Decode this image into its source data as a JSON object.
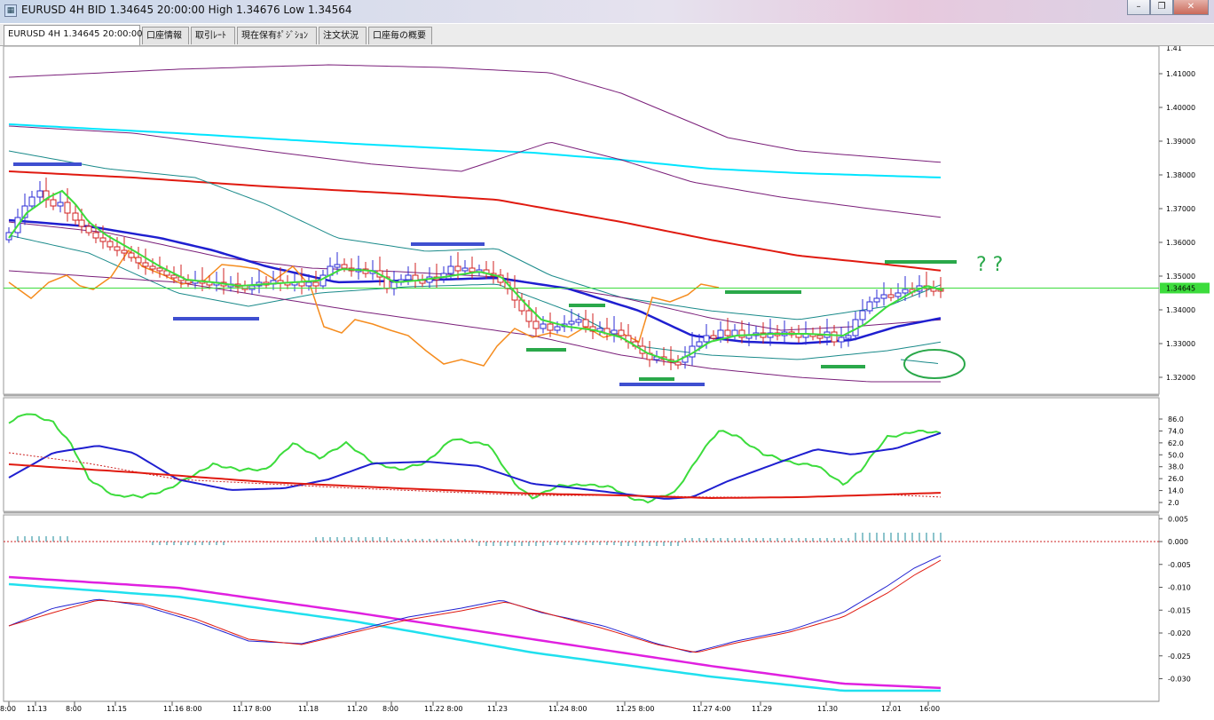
{
  "window": {
    "title": "EURUSD 4H BID 1.34645 20:00:00 High 1.34676 Low 1.34564",
    "icon": "chart-app-icon",
    "controls": [
      "minimize-icon",
      "restore-icon",
      "close-icon"
    ]
  },
  "tabs": [
    {
      "label": "EURUSD 4H 1.34645 20:00:00",
      "active": true
    },
    {
      "label": "口座情報"
    },
    {
      "label": "取引ﾚｰﾄ"
    },
    {
      "label": "現在保有ﾎﾟｼﾞｼｮﾝ"
    },
    {
      "label": "注文状況"
    },
    {
      "label": "口座毎の概要"
    }
  ],
  "chart_data": [
    {
      "type": "candlestick",
      "symbol": "EURUSD",
      "timeframe": "4H",
      "current_price": "1.34645",
      "ylim": [
        1.316,
        1.416
      ],
      "y_ticks": [
        "1.41000",
        "1.40000",
        "1.39000",
        "1.38000",
        "1.37000",
        "1.36000",
        "1.35000",
        "1.34000",
        "1.33000",
        "1.32000"
      ],
      "top_partial_tick": "1.4",
      "x_ticks": [
        "8:00",
        "11.13",
        "8:00",
        "11.15",
        "11.16 8:00",
        "11.17 8:00",
        "11.18",
        "11.20",
        "8:00",
        "11.22 8:00",
        "11.23",
        "11.24 8:00",
        "11.25 8:00",
        "11.27 4:00",
        "11.29",
        "11.30",
        "12.01",
        "16:00"
      ],
      "annotation": "? ?",
      "colors": {
        "up_candle": "#2b2bd6",
        "down_candle": "#d02020",
        "ma_fast": "#3cdc3c",
        "ma_mid": "#1f1fd0",
        "ma_slow": "#e01a10",
        "ma_long": "#00e5ff",
        "band_outer": "#7a1f7a",
        "band_inner": "#1a8a8a",
        "bar_line": "#f58c1e",
        "price_line": "#3cdc3c",
        "marks_blue": "#3f4fd0",
        "marks_green": "#2aa84a"
      }
    },
    {
      "type": "line",
      "name": "stochastic",
      "ylim": [
        0,
        100
      ],
      "y_ticks": [
        "86.0",
        "74.0",
        "62.0",
        "50.0",
        "38.0",
        "26.0",
        "14.0",
        "2.0"
      ],
      "colors": {
        "k": "#3cdc3c",
        "d": "#1f1fd0",
        "signal": "#e01a10"
      }
    },
    {
      "type": "line",
      "name": "macd",
      "ylim": [
        -0.03,
        0.005
      ],
      "y_ticks": [
        "0.005",
        "0.000",
        "-0.005",
        "-0.010",
        "-0.015",
        "-0.020",
        "-0.025",
        "-0.030"
      ],
      "colors": {
        "main": "#1f1fd0",
        "signal": "#e01a10",
        "slow1": "#e020e0",
        "slow2": "#20e0ee",
        "histogram": "#1a8a9a",
        "zero": "#cc2020"
      }
    }
  ]
}
